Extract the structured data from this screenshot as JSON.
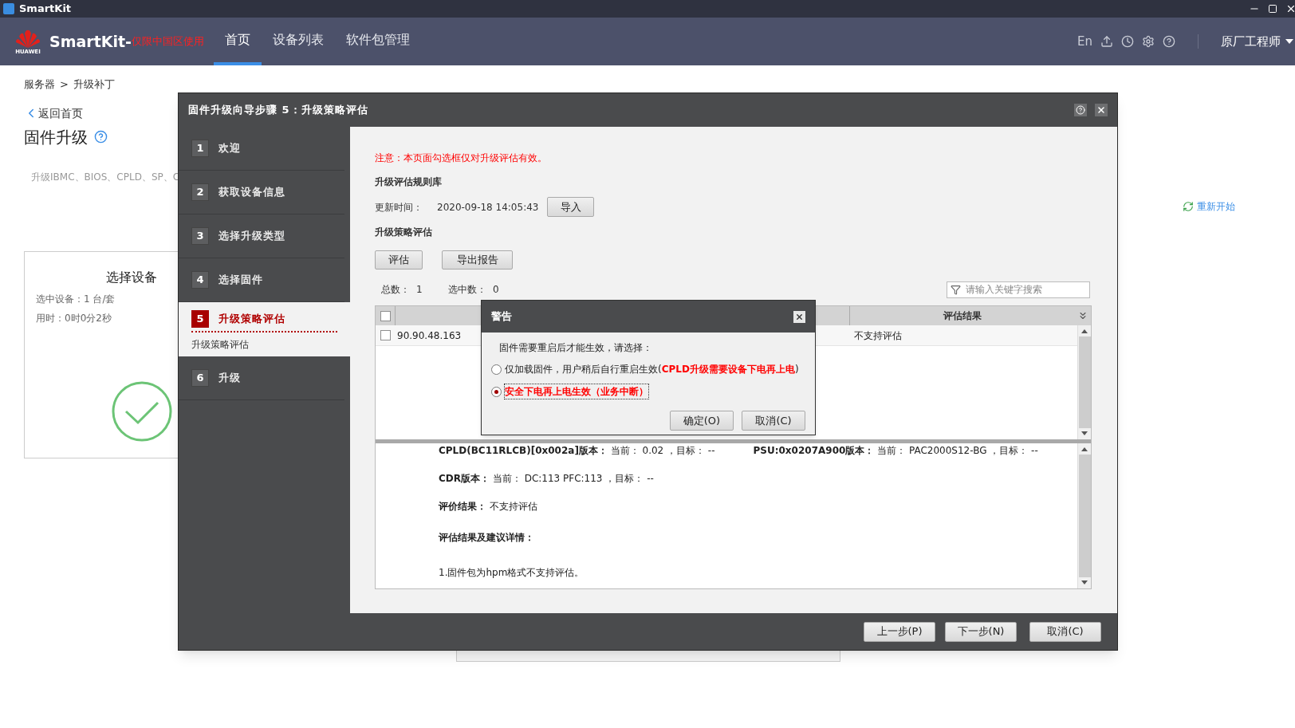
{
  "app_title": "SmartKit",
  "nav": {
    "logo_text": "HUAWEI",
    "brand": "SmartKit-",
    "brand_note": "仅限中国区使用",
    "tabs": [
      {
        "label": "首页",
        "selected": true
      },
      {
        "label": "设备列表",
        "selected": false
      },
      {
        "label": "软件包管理",
        "selected": false
      }
    ],
    "lang": "En",
    "user": "原厂工程师"
  },
  "page": {
    "breadcrumb": [
      "服务器",
      "升级补丁"
    ],
    "breadcrumb_sep": ">",
    "back": "返回首页",
    "title": "固件升级",
    "description": "升级IBMC、BIOS、CPLD、SP、C",
    "card": {
      "title": "选择设备",
      "lines": [
        "选中设备：1 台/套",
        "用时：0时0分2秒"
      ]
    },
    "restart": "重新开始"
  },
  "wizard": {
    "title": "固件升级向导步骤 5：升级策略评估",
    "steps": [
      {
        "number": "1",
        "label": "欢迎",
        "selected": false
      },
      {
        "number": "2",
        "label": "获取设备信息",
        "selected": false
      },
      {
        "number": "3",
        "label": "选择升级类型",
        "selected": false
      },
      {
        "number": "4",
        "label": "选择固件",
        "selected": false
      },
      {
        "number": "5",
        "label": "升级策略评估",
        "selected": true,
        "subtitle": "升级策略评估"
      },
      {
        "number": "6",
        "label": "升级",
        "selected": false
      }
    ],
    "notice": "注意：本页面勾选框仅对升级评估有效。",
    "rules_heading": "升级评估规则库",
    "update_label": "更新时间：",
    "update_time": "2020-09-18 14:05:43",
    "import_button": "导入",
    "strategy_heading": "升级策略评估",
    "action_buttons": [
      "评估",
      "导出报告"
    ],
    "total_label": "总数：",
    "total": "1",
    "selected_label": "选中数：",
    "selected_count": "0",
    "search": {
      "placeholder": "请输入关键字搜索"
    },
    "table": {
      "all_checked": false,
      "columns": [
        {
          "label": "评估结果"
        }
      ],
      "rows": [
        {
          "checked": false,
          "ip": "90.90.48.163",
          "result": "不支持评估"
        }
      ]
    },
    "details": [
      {
        "kind": "versions",
        "items": [
          {
            "label": "CPLD(BC11RLCB)[0x002a]版本：",
            "value": "当前： 0.02 ，目标： --"
          },
          {
            "label": "PSU:0x0207A900版本：",
            "value": "当前： PAC2000S12-BG ，目标： --"
          }
        ]
      },
      {
        "kind": "versions",
        "items": [
          {
            "label": "CDR版本：",
            "value": "当前： DC:113 PFC:113 ，目标： --"
          }
        ]
      },
      {
        "kind": "versions",
        "items": [
          {
            "label": "评价结果：",
            "value": "不支持评估"
          }
        ]
      },
      {
        "kind": "heading",
        "text": "评估结果及建议详情："
      },
      {
        "kind": "text",
        "text": "1.固件包为hpm格式不支持评估。"
      }
    ],
    "footer_buttons": [
      "上一步(P)",
      "下一步(N)",
      "取消(C)"
    ]
  },
  "warning": {
    "title": "警告",
    "message": "固件需要重启后才能生效，请选择：",
    "options": [
      {
        "selected": false,
        "parts": [
          {
            "kind": "plain",
            "text": "仅加载固件，用户稍后自行重启生效("
          },
          {
            "kind": "alert",
            "text": "CPLD升级需要设备下电再上电"
          },
          {
            "kind": "plain",
            "text": ")"
          }
        ]
      },
      {
        "selected": true,
        "parts": [
          {
            "kind": "alert",
            "text": "安全下电再上电生效（业务中断）"
          }
        ]
      }
    ],
    "buttons": [
      "确定(O)",
      "取消(C)"
    ]
  }
}
